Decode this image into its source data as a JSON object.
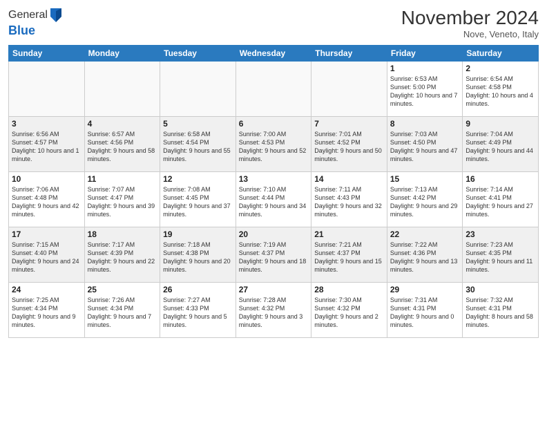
{
  "header": {
    "logo_line1": "General",
    "logo_line2": "Blue",
    "month_title": "November 2024",
    "subtitle": "Nove, Veneto, Italy"
  },
  "days_of_week": [
    "Sunday",
    "Monday",
    "Tuesday",
    "Wednesday",
    "Thursday",
    "Friday",
    "Saturday"
  ],
  "weeks": [
    [
      {
        "day": "",
        "info": ""
      },
      {
        "day": "",
        "info": ""
      },
      {
        "day": "",
        "info": ""
      },
      {
        "day": "",
        "info": ""
      },
      {
        "day": "",
        "info": ""
      },
      {
        "day": "1",
        "info": "Sunrise: 6:53 AM\nSunset: 5:00 PM\nDaylight: 10 hours and 7 minutes."
      },
      {
        "day": "2",
        "info": "Sunrise: 6:54 AM\nSunset: 4:58 PM\nDaylight: 10 hours and 4 minutes."
      }
    ],
    [
      {
        "day": "3",
        "info": "Sunrise: 6:56 AM\nSunset: 4:57 PM\nDaylight: 10 hours and 1 minute."
      },
      {
        "day": "4",
        "info": "Sunrise: 6:57 AM\nSunset: 4:56 PM\nDaylight: 9 hours and 58 minutes."
      },
      {
        "day": "5",
        "info": "Sunrise: 6:58 AM\nSunset: 4:54 PM\nDaylight: 9 hours and 55 minutes."
      },
      {
        "day": "6",
        "info": "Sunrise: 7:00 AM\nSunset: 4:53 PM\nDaylight: 9 hours and 52 minutes."
      },
      {
        "day": "7",
        "info": "Sunrise: 7:01 AM\nSunset: 4:52 PM\nDaylight: 9 hours and 50 minutes."
      },
      {
        "day": "8",
        "info": "Sunrise: 7:03 AM\nSunset: 4:50 PM\nDaylight: 9 hours and 47 minutes."
      },
      {
        "day": "9",
        "info": "Sunrise: 7:04 AM\nSunset: 4:49 PM\nDaylight: 9 hours and 44 minutes."
      }
    ],
    [
      {
        "day": "10",
        "info": "Sunrise: 7:06 AM\nSunset: 4:48 PM\nDaylight: 9 hours and 42 minutes."
      },
      {
        "day": "11",
        "info": "Sunrise: 7:07 AM\nSunset: 4:47 PM\nDaylight: 9 hours and 39 minutes."
      },
      {
        "day": "12",
        "info": "Sunrise: 7:08 AM\nSunset: 4:45 PM\nDaylight: 9 hours and 37 minutes."
      },
      {
        "day": "13",
        "info": "Sunrise: 7:10 AM\nSunset: 4:44 PM\nDaylight: 9 hours and 34 minutes."
      },
      {
        "day": "14",
        "info": "Sunrise: 7:11 AM\nSunset: 4:43 PM\nDaylight: 9 hours and 32 minutes."
      },
      {
        "day": "15",
        "info": "Sunrise: 7:13 AM\nSunset: 4:42 PM\nDaylight: 9 hours and 29 minutes."
      },
      {
        "day": "16",
        "info": "Sunrise: 7:14 AM\nSunset: 4:41 PM\nDaylight: 9 hours and 27 minutes."
      }
    ],
    [
      {
        "day": "17",
        "info": "Sunrise: 7:15 AM\nSunset: 4:40 PM\nDaylight: 9 hours and 24 minutes."
      },
      {
        "day": "18",
        "info": "Sunrise: 7:17 AM\nSunset: 4:39 PM\nDaylight: 9 hours and 22 minutes."
      },
      {
        "day": "19",
        "info": "Sunrise: 7:18 AM\nSunset: 4:38 PM\nDaylight: 9 hours and 20 minutes."
      },
      {
        "day": "20",
        "info": "Sunrise: 7:19 AM\nSunset: 4:37 PM\nDaylight: 9 hours and 18 minutes."
      },
      {
        "day": "21",
        "info": "Sunrise: 7:21 AM\nSunset: 4:37 PM\nDaylight: 9 hours and 15 minutes."
      },
      {
        "day": "22",
        "info": "Sunrise: 7:22 AM\nSunset: 4:36 PM\nDaylight: 9 hours and 13 minutes."
      },
      {
        "day": "23",
        "info": "Sunrise: 7:23 AM\nSunset: 4:35 PM\nDaylight: 9 hours and 11 minutes."
      }
    ],
    [
      {
        "day": "24",
        "info": "Sunrise: 7:25 AM\nSunset: 4:34 PM\nDaylight: 9 hours and 9 minutes."
      },
      {
        "day": "25",
        "info": "Sunrise: 7:26 AM\nSunset: 4:34 PM\nDaylight: 9 hours and 7 minutes."
      },
      {
        "day": "26",
        "info": "Sunrise: 7:27 AM\nSunset: 4:33 PM\nDaylight: 9 hours and 5 minutes."
      },
      {
        "day": "27",
        "info": "Sunrise: 7:28 AM\nSunset: 4:32 PM\nDaylight: 9 hours and 3 minutes."
      },
      {
        "day": "28",
        "info": "Sunrise: 7:30 AM\nSunset: 4:32 PM\nDaylight: 9 hours and 2 minutes."
      },
      {
        "day": "29",
        "info": "Sunrise: 7:31 AM\nSunset: 4:31 PM\nDaylight: 9 hours and 0 minutes."
      },
      {
        "day": "30",
        "info": "Sunrise: 7:32 AM\nSunset: 4:31 PM\nDaylight: 8 hours and 58 minutes."
      }
    ]
  ]
}
